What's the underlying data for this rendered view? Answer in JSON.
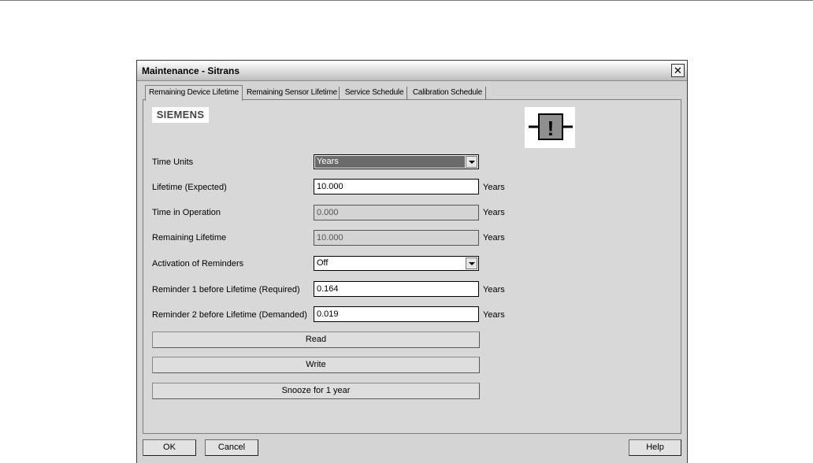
{
  "window": {
    "title": "Maintenance - Sitrans",
    "close_glyph": "✕"
  },
  "tabs": [
    {
      "label": "Remaining Device Lifetime",
      "active": true
    },
    {
      "label": "Remaining Sensor Lifetime",
      "active": false
    },
    {
      "label": "Service Schedule",
      "active": false
    },
    {
      "label": "Calibration Schedule",
      "active": false
    }
  ],
  "logo": "SIEMENS",
  "status_icon": {
    "name": "maintenance-required-icon",
    "glyph": "!"
  },
  "form": {
    "time_units": {
      "label": "Time Units",
      "value": "Years"
    },
    "lifetime_expected": {
      "label": "Lifetime (Expected)",
      "value": "10.000",
      "unit": "Years"
    },
    "time_in_operation": {
      "label": "Time in Operation",
      "value": "0.000",
      "unit": "Years"
    },
    "remaining_lifetime": {
      "label": "Remaining Lifetime",
      "value": "10.000",
      "unit": "Years"
    },
    "activation_of_reminders": {
      "label": "Activation of Reminders",
      "value": "Off"
    },
    "reminder1": {
      "label": "Reminder 1 before Lifetime (Required)",
      "value": "0.164",
      "unit": "Years"
    },
    "reminder2": {
      "label": "Reminder 2 before Lifetime (Demanded)",
      "value": "0.019",
      "unit": "Years"
    }
  },
  "actions": {
    "read": "Read",
    "write": "Write",
    "snooze": "Snooze for 1 year"
  },
  "buttons": {
    "ok": "OK",
    "cancel": "Cancel",
    "help": "Help"
  }
}
